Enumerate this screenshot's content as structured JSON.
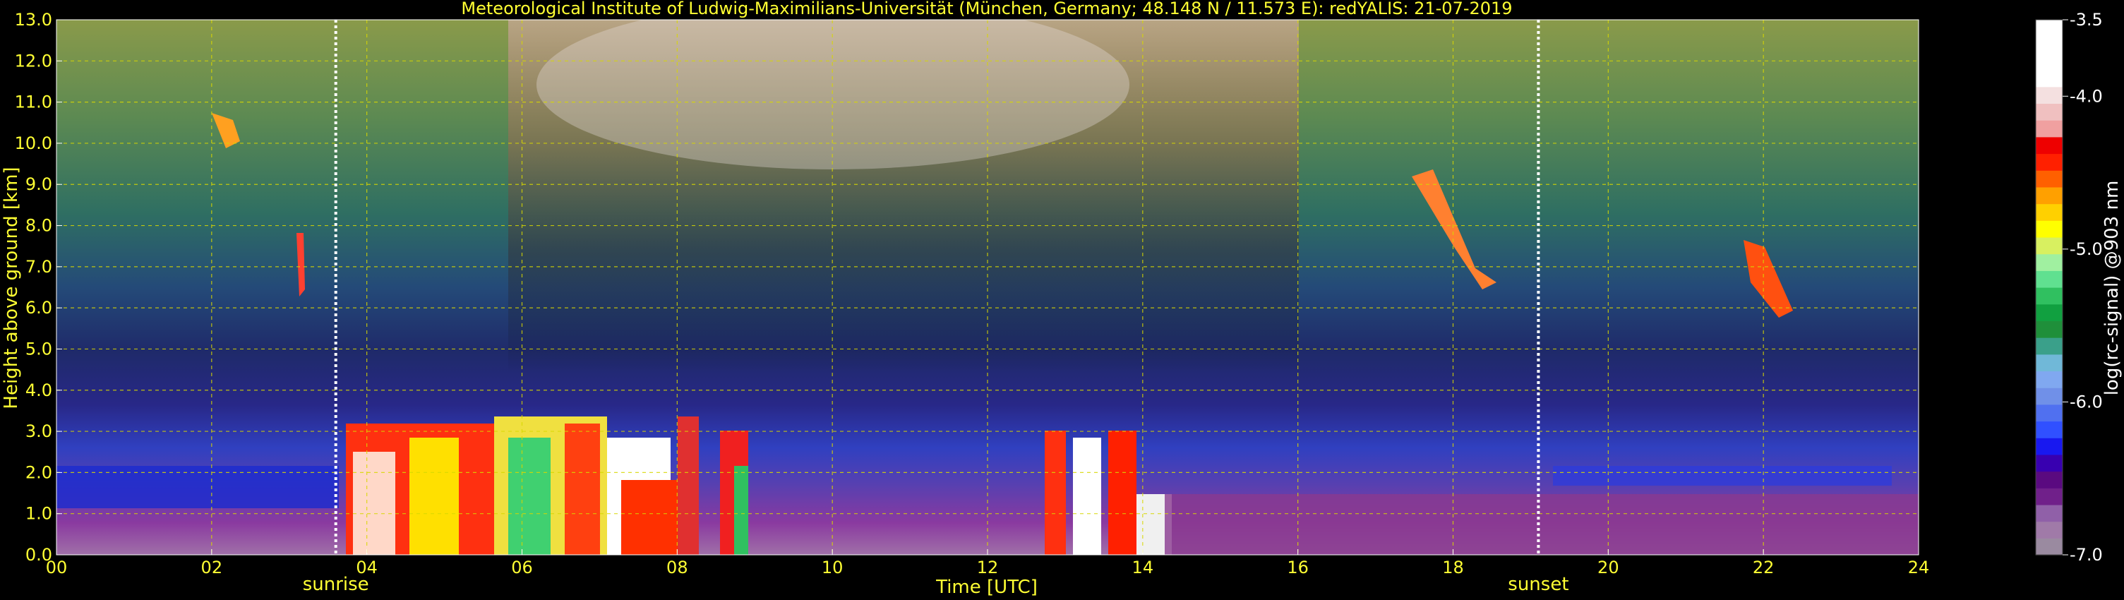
{
  "chart_data": {
    "type": "heatmap",
    "title": "Meteorological Institute of Ludwig-Maximilians-Universität (München, Germany; 48.148 N / 11.573 E):    redYALIS: 21-07-2019",
    "xlabel": "Time [UTC]",
    "ylabel": "Height above ground [km]",
    "xlim": [
      0,
      24
    ],
    "ylim": [
      0,
      13
    ],
    "x_ticks": [
      "00",
      "02",
      "04",
      "06",
      "08",
      "10",
      "12",
      "14",
      "16",
      "18",
      "20",
      "22",
      "24"
    ],
    "y_ticks": [
      "0.0",
      "1.0",
      "2.0",
      "3.0",
      "4.0",
      "5.0",
      "6.0",
      "7.0",
      "8.0",
      "9.0",
      "10.0",
      "11.0",
      "12.0",
      "13.0"
    ],
    "grid": true,
    "markers": [
      {
        "label": "sunrise",
        "time_utc": 3.6
      },
      {
        "label": "sunset",
        "time_utc": 19.1
      }
    ],
    "colorbar": {
      "label": "log(rc-signal) @903 nm",
      "range": [
        -7.0,
        -3.5
      ],
      "ticks": [
        "-3.5",
        "-4.0",
        "-5.0",
        "-6.0",
        "-7.0"
      ],
      "tick_values": [
        -3.5,
        -4.0,
        -5.0,
        -6.0,
        -7.0
      ],
      "colors": [
        "#9a8aa0",
        "#a07aa8",
        "#9060a8",
        "#70208a",
        "#5a0a80",
        "#3800b0",
        "#1818f0",
        "#3050ff",
        "#5070f0",
        "#7090e8",
        "#80a8f0",
        "#70b8d8",
        "#3aa08a",
        "#1f8f3a",
        "#11a040",
        "#30c060",
        "#60e090",
        "#a0f0a0",
        "#d8f060",
        "#ffff00",
        "#ffd000",
        "#ffa000",
        "#ff6000",
        "#ff2000",
        "#ee0000",
        "#f0a0a0",
        "#f0c0c0",
        "#f4e0e0",
        "#ffffff",
        "#ffffff",
        "#ffffff",
        "#ffffff"
      ]
    }
  }
}
